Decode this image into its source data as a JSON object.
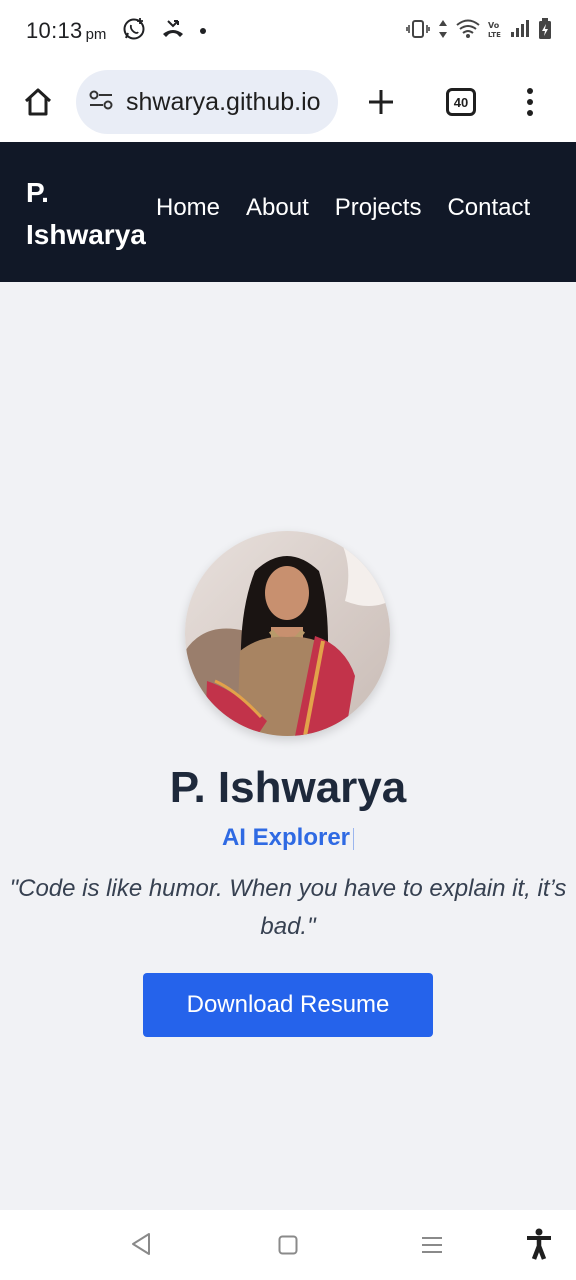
{
  "status_bar": {
    "time": "10:13",
    "time_suffix": "pm",
    "tab_count": "40"
  },
  "browser": {
    "url": "shwarya.github.io"
  },
  "site": {
    "brand": "P. Ishwarya",
    "nav": [
      "Home",
      "About",
      "Projects",
      "Contact"
    ]
  },
  "hero": {
    "name": "P. Ishwarya",
    "role": "AI Explorer",
    "quote": "\"Code is like humor. When you have to explain it, it’s bad.\"",
    "button_label": "Download Resume"
  },
  "colors": {
    "nav_bg": "#111827",
    "page_bg": "#f1f2f5",
    "accent": "#2563eb",
    "role_text": "#2f6ae3"
  },
  "icons": {
    "home": "home-icon",
    "site_info": "tune-icon",
    "new_tab": "plus-icon",
    "more": "more-vert-icon",
    "whatsapp": "whatsapp-icon",
    "missed_call": "missed-call-icon",
    "vibrate": "vibrate-icon",
    "wifi": "wifi-icon",
    "signal": "signal-icon",
    "battery": "battery-icon"
  }
}
